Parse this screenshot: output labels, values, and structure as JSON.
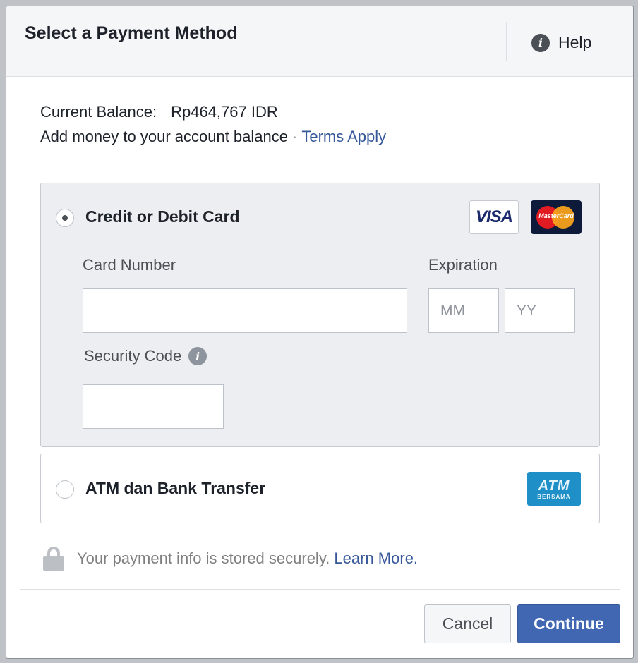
{
  "dialog": {
    "title": "Select a Payment Method",
    "help_label": "Help",
    "help_icon": "info-icon"
  },
  "balance": {
    "label": "Current Balance:",
    "amount": "Rp464,767 IDR"
  },
  "add_money": {
    "text": "Add money to your account balance",
    "separator": "·",
    "terms_link": "Terms Apply"
  },
  "card_option": {
    "label": "Credit or Debit Card",
    "selected": true,
    "visa_text": "VISA",
    "mastercard_text": "MasterCard",
    "card_number_label": "Card Number",
    "card_number_value": "",
    "expiration_label": "Expiration",
    "month_placeholder": "MM",
    "year_placeholder": "YY",
    "security_code_label": "Security Code",
    "security_code_value": ""
  },
  "atm_option": {
    "label": "ATM dan Bank Transfer",
    "selected": false,
    "logo_text": "ATM",
    "logo_subtext": "BERSAMA"
  },
  "secure_note": {
    "text": "Your payment info is stored securely.",
    "link": "Learn More."
  },
  "footer": {
    "cancel_label": "Cancel",
    "continue_label": "Continue"
  },
  "colors": {
    "accent": "#4267b2",
    "link": "#365899",
    "panel_bg": "#eceef1"
  }
}
